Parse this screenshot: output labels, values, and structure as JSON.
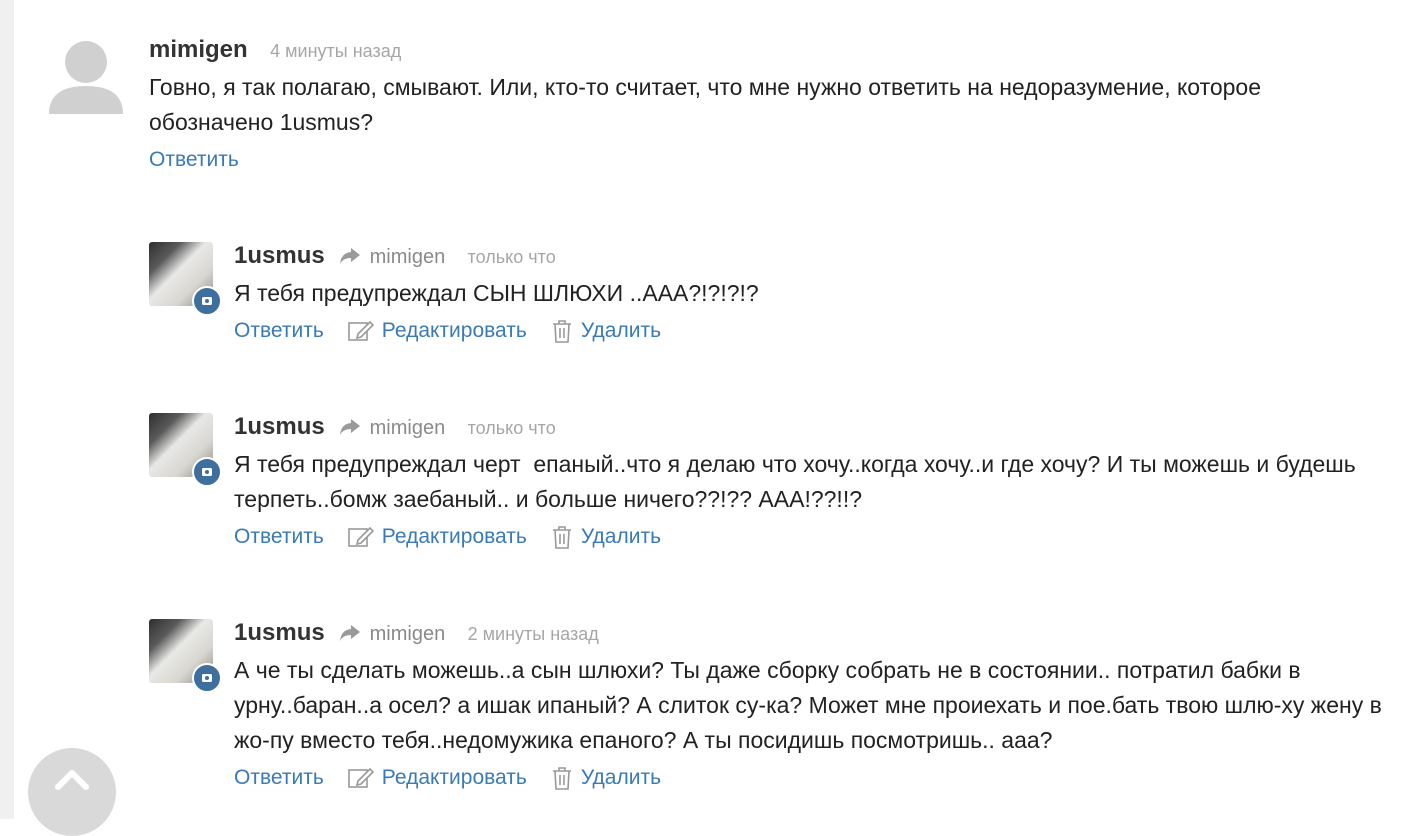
{
  "comments": [
    {
      "author": "mimigen",
      "time": "4 минуты назад",
      "text": "Говно, я так полагаю, смывают. Или, кто-то считает, что мне нужно ответить на недоразумение, которое обозначено 1usmus?",
      "reply_label": "Ответить"
    }
  ],
  "replies": [
    {
      "author": "1usmus",
      "reply_to": "mimigen",
      "time": "только что",
      "text": "Я тебя предупреждал СЫН ШЛЮХИ ..ААА?!?!?!?",
      "reply_label": "Ответить",
      "edit_label": "Редактировать",
      "delete_label": "Удалить"
    },
    {
      "author": "1usmus",
      "reply_to": "mimigen",
      "time": "только что",
      "text": "Я тебя предупреждал черт  епаный..что я делаю что хочу..когда хочу..и где хочу? И ты можешь и будешь терпеть..бомж заебаный.. и больше ничего??!?? ААА!??!!?",
      "reply_label": "Ответить",
      "edit_label": "Редактировать",
      "delete_label": "Удалить"
    },
    {
      "author": "1usmus",
      "reply_to": "mimigen",
      "time": "2 минуты назад",
      "text": "А че ты сделать можешь..а сын шлюхи? Ты даже сборку собрать не в состоянии.. потратил бабки в урну..баран..а осел? а ишак ипаный? А слиток су-ка? Может мне проиехать и пое.бать твою шлю-ху жену в жо-пу вместо тебя..недомужика епаного? А ты посидишь посмотришь.. ааа?",
      "reply_label": "Ответить",
      "edit_label": "Редактировать",
      "delete_label": "Удалить"
    }
  ],
  "icons": {
    "avatar_default": "user-silhouette-icon",
    "reply_arrow": "reply-arrow-icon",
    "edit": "pencil-edit-icon",
    "delete": "trash-icon",
    "scroll_top": "chevron-up-icon",
    "badge": "camera-badge-icon"
  },
  "colors": {
    "link": "#3a7ab5",
    "muted": "#a6a6a6",
    "badge": "#3f6f9c"
  }
}
